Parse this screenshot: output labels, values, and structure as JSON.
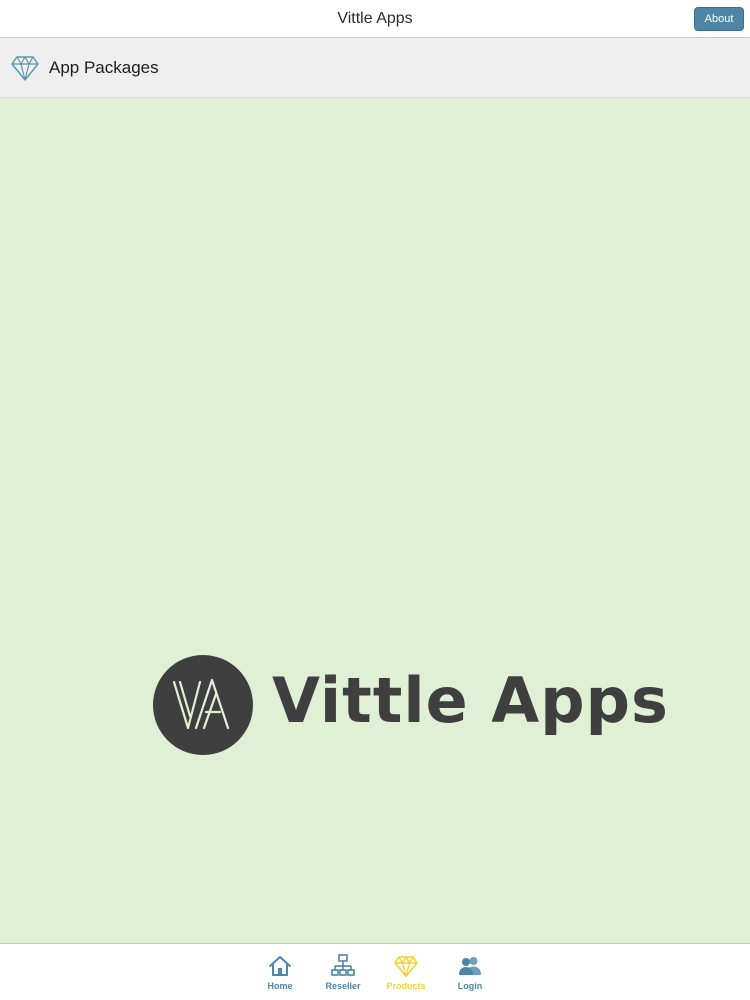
{
  "header": {
    "title": "Vittle Apps",
    "about_label": "About"
  },
  "section": {
    "title": "App Packages",
    "icon": "diamond-icon"
  },
  "logo": {
    "text": "Vittle Apps",
    "mark_letters": "VA"
  },
  "tabs": [
    {
      "label": "Home",
      "icon": "home-icon",
      "active": false
    },
    {
      "label": "Reseller",
      "icon": "network-icon",
      "active": false
    },
    {
      "label": "Products",
      "icon": "diamond-icon",
      "active": true
    },
    {
      "label": "Login",
      "icon": "users-icon",
      "active": false
    }
  ],
  "colors": {
    "content_background": "#dff0d4",
    "accent": "#4e87a5",
    "active_tab": "#f2d22f",
    "logo": "#3f3f3f"
  }
}
